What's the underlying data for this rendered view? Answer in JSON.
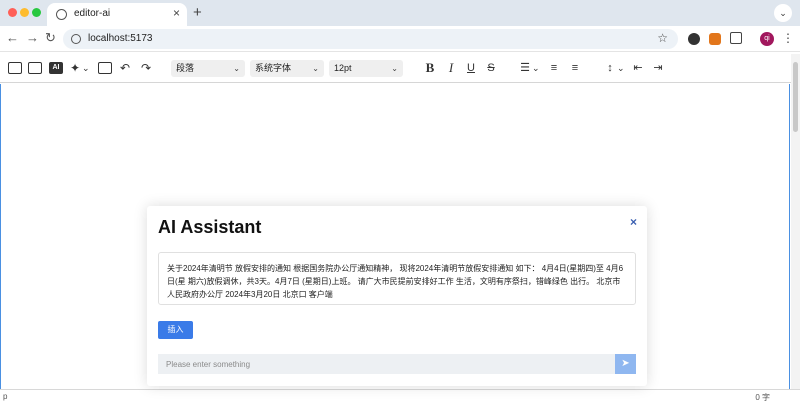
{
  "browser": {
    "tab_title": "editor-ai",
    "tab_close": "×",
    "new_tab": "+",
    "url": "localhost:5173",
    "back": "←",
    "forward": "→",
    "reload": "↻",
    "star": "☆",
    "profile_initial": "qi",
    "menu": "⋮",
    "tab_menu": "⌄"
  },
  "toolbar": {
    "paragraph_select": "段落",
    "font_family_select": "系统字体",
    "font_size_select": "12pt",
    "ai_label": "AI",
    "bold": "B",
    "italic": "I",
    "underline": "U",
    "strike": "S",
    "undo": "↶",
    "redo": "↷",
    "chevron": "⌄"
  },
  "statusbar": {
    "path": "p",
    "word_count": "0 字"
  },
  "modal": {
    "title": "AI Assistant",
    "close": "×",
    "result_text": "关于2024年清明节 放假安排的通知 根据国务院办公厅通知精神， 现将2024年清明节放假安排通知 如下： 4月4日(星期四)至 4月6日(星 期六)放假调休，共3天。4月7日 (星期日)上班。 请广大市民提前安排好工作 生活，文明有序祭扫，错峰绿色 出行。 北京市人民政府办公厅 2024年3月20日 北京口 客户端",
    "insert_button": "插入",
    "prompt_placeholder": "Please enter something",
    "send_icon": "➤"
  },
  "colors": {
    "accent": "#3a7be8",
    "send_button": "#8fb7f0",
    "editor_border": "#4a90e2"
  }
}
